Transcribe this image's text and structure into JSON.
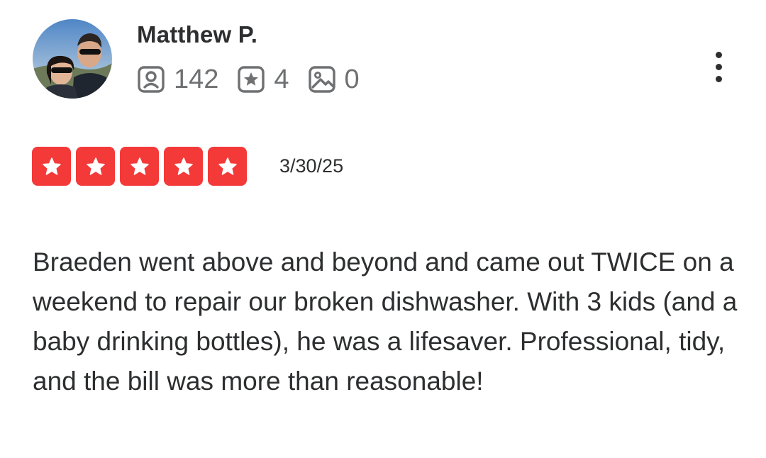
{
  "review": {
    "user": {
      "name": "Matthew P.",
      "avatar_icon": "user-photo-avatar",
      "stats": {
        "friends": "142",
        "reviews": "4",
        "photos": "0"
      }
    },
    "rating": 5,
    "max_rating": 5,
    "date": "3/30/25",
    "text": "Braeden went above and beyond and came out TWICE on a weekend to repair our broken dishwasher. With 3 kids (and a baby drinking bottles), he was a lifesaver. Professional, tidy, and the bill was more than reasonable!"
  },
  "colors": {
    "star_fill": "#f43939",
    "text_primary": "#2d2e2f",
    "text_secondary": "#6e7072"
  },
  "icons": {
    "friends": "friends-icon",
    "reviews": "reviews-star-icon",
    "photos": "photo-icon",
    "more": "more-options-icon",
    "star": "star-icon"
  }
}
